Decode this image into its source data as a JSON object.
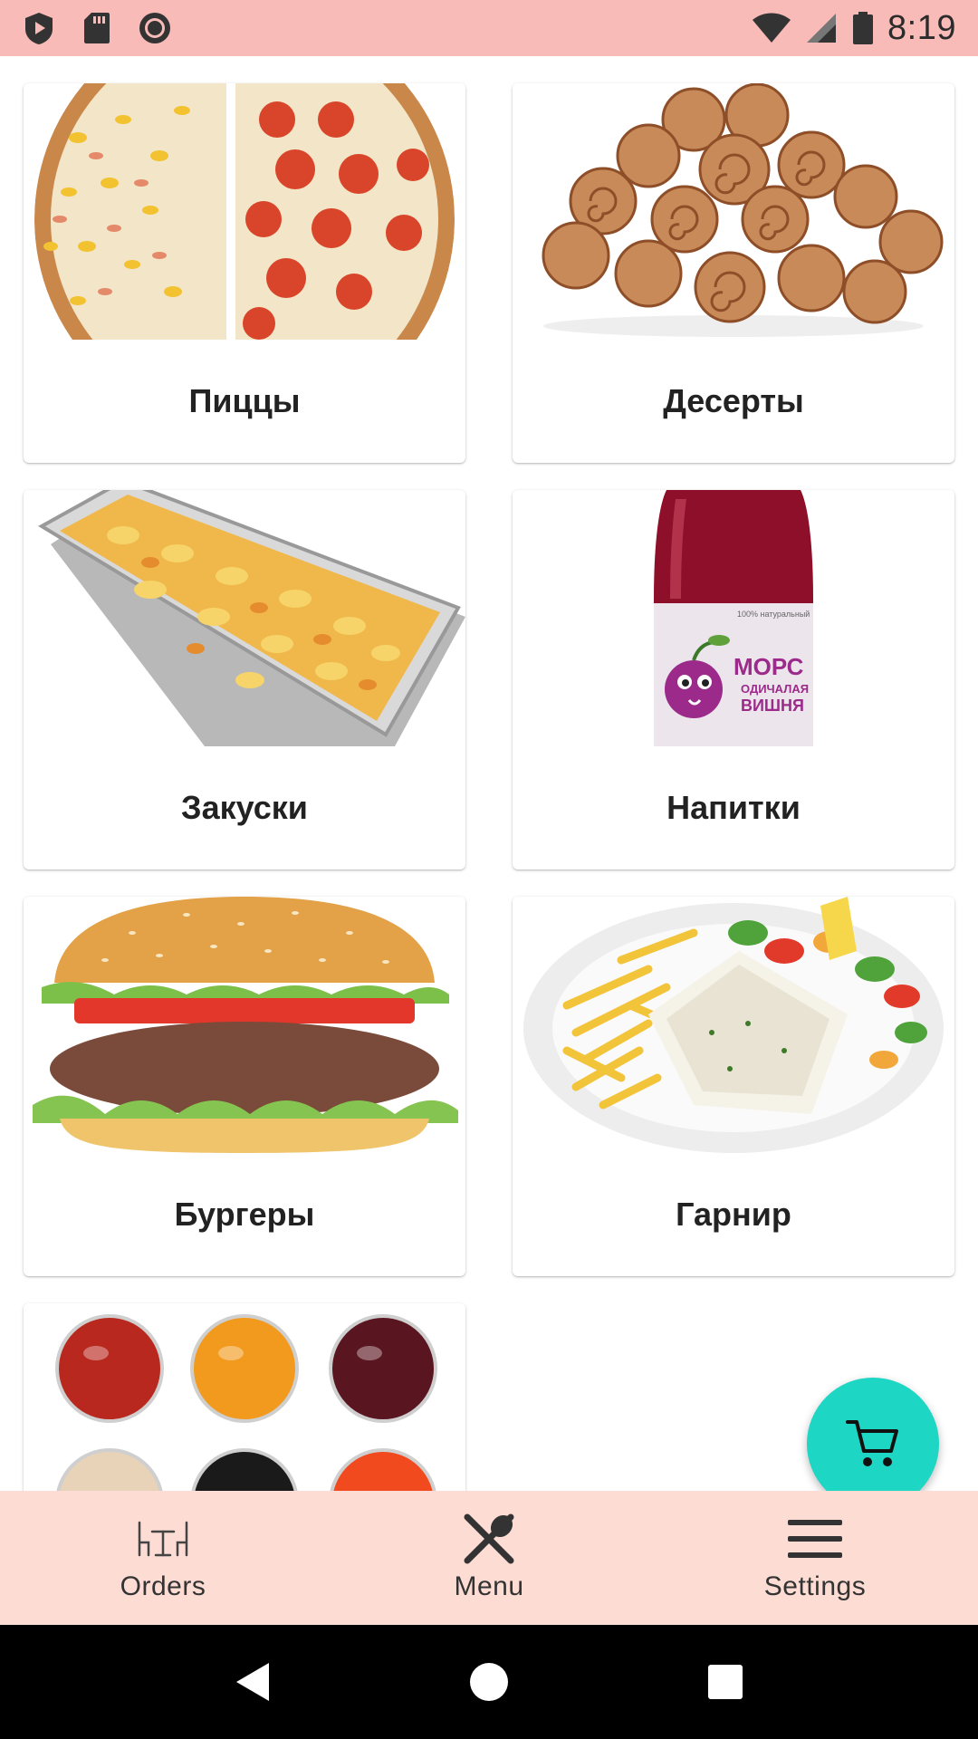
{
  "status_bar": {
    "time": "8:19",
    "left_icons": [
      "play-shield-icon",
      "sd-card-icon",
      "record-icon"
    ],
    "right_icons": [
      "wifi-icon",
      "cell-signal-icon",
      "battery-icon"
    ]
  },
  "categories": [
    {
      "label": "Пиццы",
      "image": "pizza-image"
    },
    {
      "label": "Десерты",
      "image": "cinnamon-rolls-image"
    },
    {
      "label": "Закуски",
      "image": "pasta-tray-image"
    },
    {
      "label": "Напитки",
      "image": "drink-bottle-image"
    },
    {
      "label": "Бургеры",
      "image": "burger-image"
    },
    {
      "label": "Гарнир",
      "image": "fish-fries-plate-image"
    },
    {
      "label": "",
      "image": "sauces-image"
    }
  ],
  "drink_bottle": {
    "brand_small": "100% натуральный",
    "brand": "МОРС",
    "flavor_line1": "ОДИЧАЛАЯ",
    "flavor_line2": "ВИШНЯ"
  },
  "fab": {
    "icon": "cart-icon"
  },
  "bottom_nav": [
    {
      "label": "Orders",
      "icon": "table-chairs-icon"
    },
    {
      "label": "Menu",
      "icon": "fork-knife-icon"
    },
    {
      "label": "Settings",
      "icon": "hamburger-menu-icon"
    }
  ],
  "colors": {
    "status_bar": "#F8BBB7",
    "bottom_nav": "#FDDCD4",
    "fab": "#1DD6C4"
  }
}
